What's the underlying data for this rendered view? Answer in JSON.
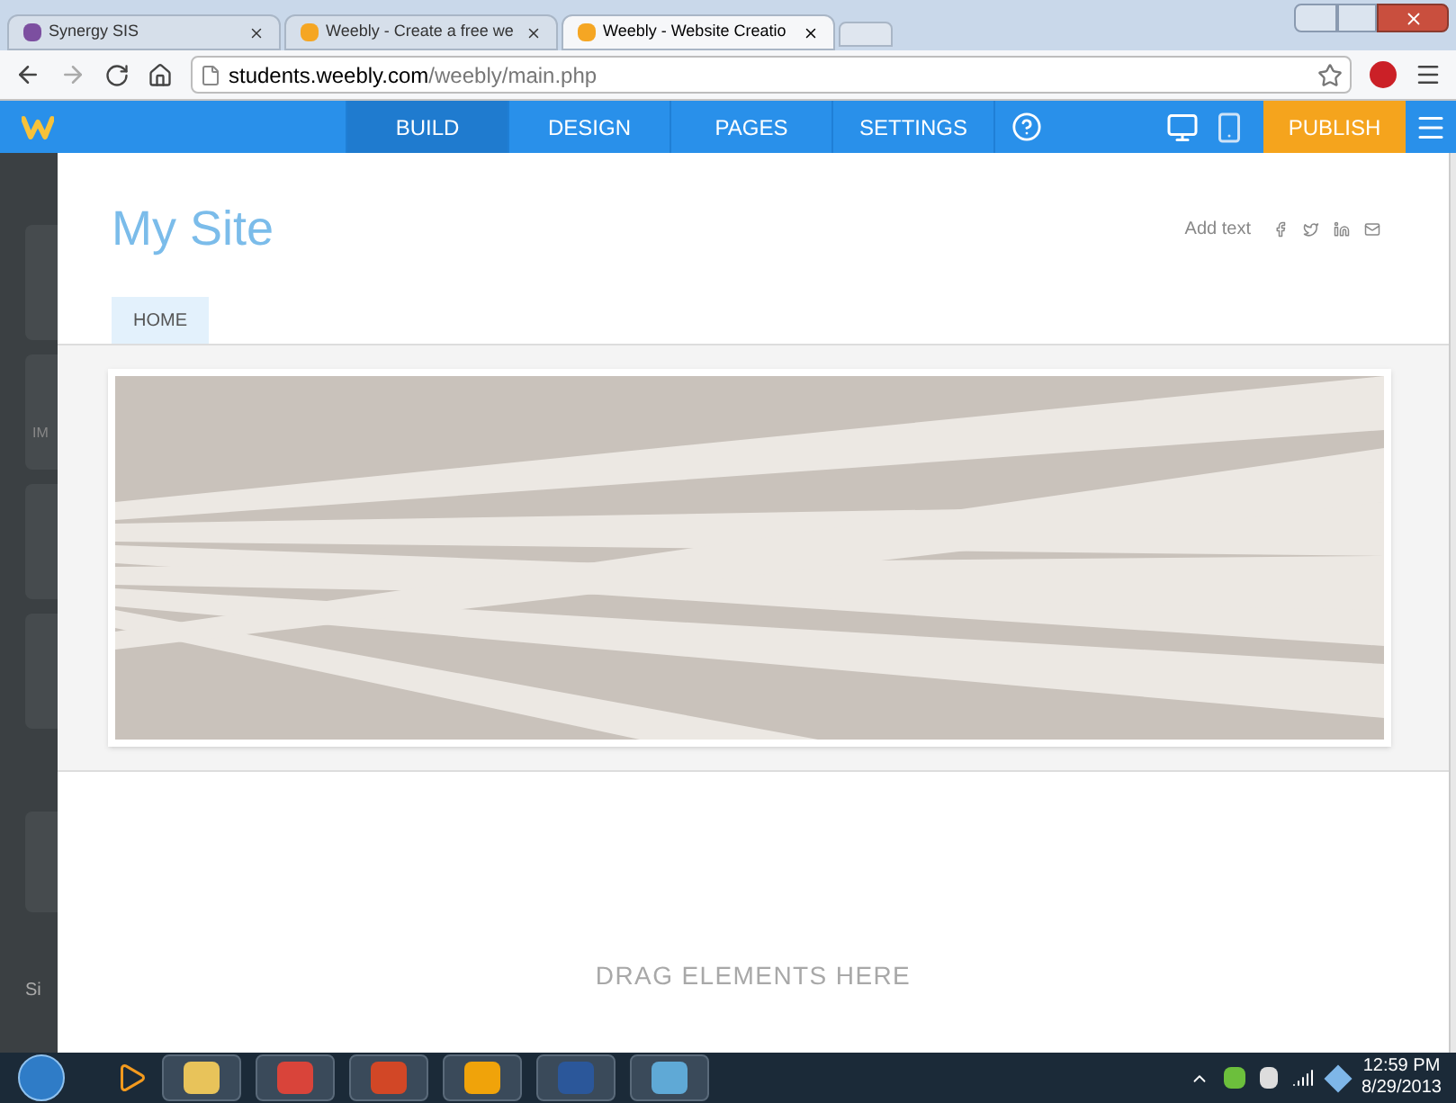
{
  "browser": {
    "tabs": [
      {
        "title": "Synergy SIS",
        "selected": false
      },
      {
        "title": "Weebly - Create a free we",
        "selected": false
      },
      {
        "title": "Weebly - Website Creatio",
        "selected": true
      }
    ],
    "address": {
      "host": "students.weebly.com",
      "path": "/weebly/main.php"
    }
  },
  "editor": {
    "tabs": [
      {
        "label": "BUILD",
        "selected": true
      },
      {
        "label": "DESIGN",
        "selected": false
      },
      {
        "label": "PAGES",
        "selected": false
      },
      {
        "label": "SETTINGS",
        "selected": false
      }
    ],
    "publish": "PUBLISH"
  },
  "sidebar": {
    "labels": [
      "IM",
      "Si"
    ]
  },
  "site": {
    "title": "My Site",
    "add_text": "Add text",
    "nav": [
      {
        "label": "HOME",
        "selected": true
      }
    ],
    "drop_hint": "DRAG ELEMENTS HERE"
  },
  "taskbar": {
    "time": "12:59 PM",
    "date": "8/29/2013"
  }
}
